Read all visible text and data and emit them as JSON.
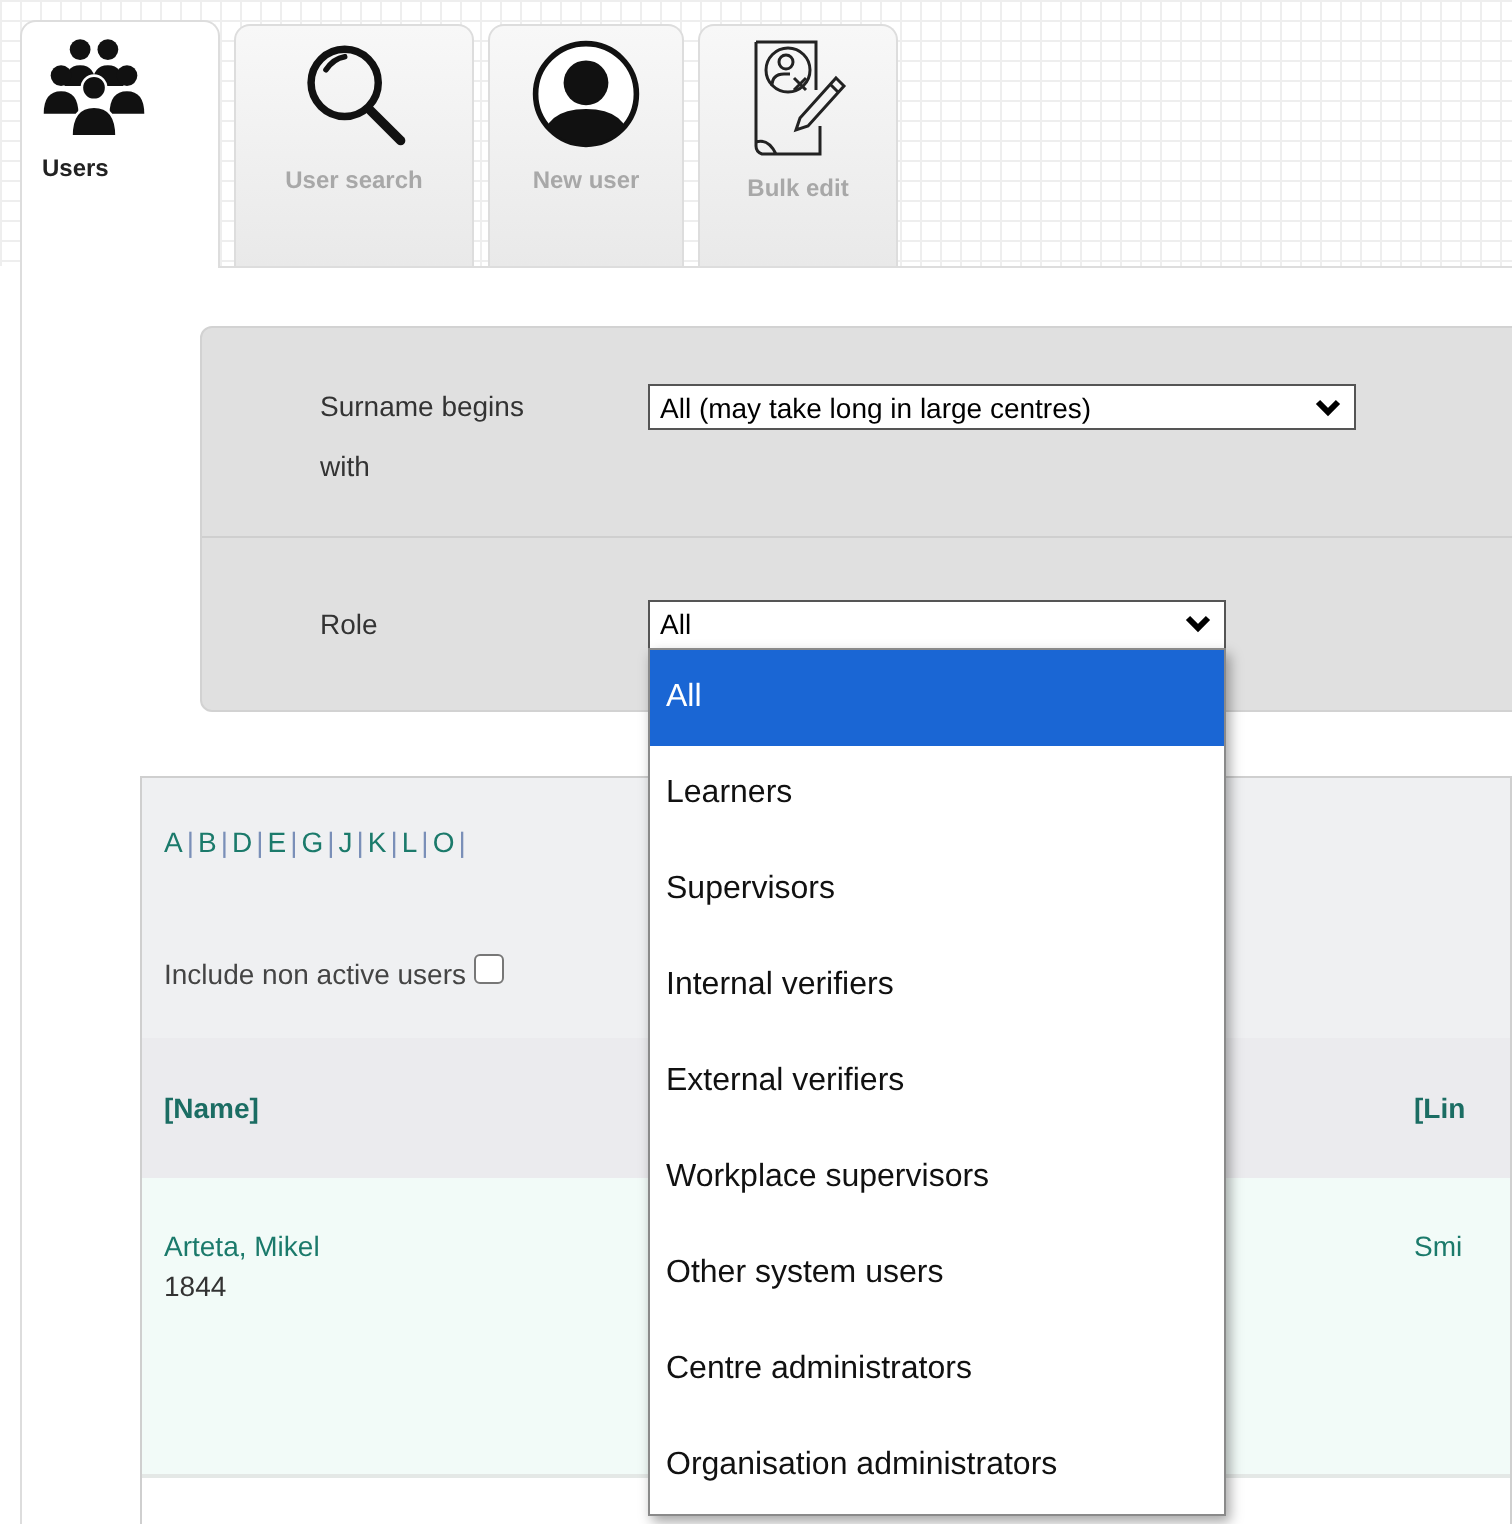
{
  "tabs": [
    {
      "label": "Users",
      "kind": "group",
      "selected": true
    },
    {
      "label": "User search",
      "kind": "search",
      "selected": false
    },
    {
      "label": "New user",
      "kind": "person",
      "selected": false
    },
    {
      "label": "Bulk edit",
      "kind": "document",
      "selected": false
    }
  ],
  "filters": [
    {
      "label": "Surname begins with",
      "value": "All (may take long in large centres)"
    },
    {
      "label": "Role",
      "value": "All",
      "open": true,
      "options": [
        {
          "label": "All",
          "selected": true
        },
        {
          "label": "Learners",
          "selected": false
        },
        {
          "label": "Supervisors",
          "selected": false
        },
        {
          "label": "Internal verifiers",
          "selected": false
        },
        {
          "label": "External verifiers",
          "selected": false
        },
        {
          "label": "Workplace supervisors",
          "selected": false
        },
        {
          "label": "Other system users",
          "selected": false
        },
        {
          "label": "Centre administrators",
          "selected": false
        },
        {
          "label": "Organisation administrators",
          "selected": false
        }
      ]
    }
  ],
  "letters": [
    {
      "letter": "A",
      "separator": "|"
    },
    {
      "letter": "B",
      "separator": "|"
    },
    {
      "letter": "D",
      "separator": "|"
    },
    {
      "letter": "E",
      "separator": "|"
    },
    {
      "letter": "G",
      "separator": "|"
    },
    {
      "letter": "J",
      "separator": "|"
    },
    {
      "letter": "K",
      "separator": "|"
    },
    {
      "letter": "L",
      "separator": "|"
    },
    {
      "letter": "O",
      "separator": "|"
    }
  ],
  "include_inactive": {
    "label": "Include non active users",
    "checked": false
  },
  "table": {
    "columns": [
      "[Name]",
      "[Lin"
    ],
    "rows": [
      {
        "name": "Arteta, Mikel",
        "id": "1844",
        "column_2": "Smi"
      }
    ]
  }
}
